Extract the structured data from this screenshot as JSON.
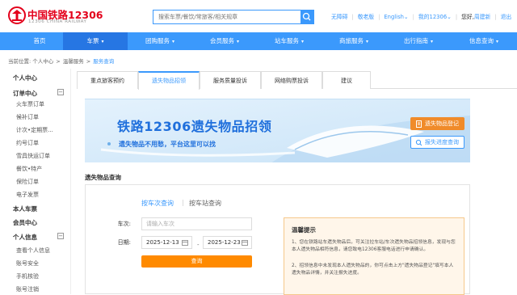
{
  "header": {
    "logo_cn": "中国铁路12306",
    "logo_en": "12306 CHINA RAILWAY",
    "search_placeholder": "搜索车票/餐饮/常旅客/相关规章",
    "links": [
      "无障碍",
      "敬老版",
      "English",
      "我的12306",
      "您好,",
      "周建新",
      "退出"
    ]
  },
  "nav": [
    {
      "label": "首页",
      "chev": false
    },
    {
      "label": "车票",
      "chev": true,
      "active": true
    },
    {
      "label": "团购服务",
      "chev": true
    },
    {
      "label": "会员服务",
      "chev": true
    },
    {
      "label": "站车服务",
      "chev": true
    },
    {
      "label": "商旅服务",
      "chev": true
    },
    {
      "label": "出行指南",
      "chev": true
    },
    {
      "label": "信息查询",
      "chev": true
    }
  ],
  "breadcrumb": {
    "prefix": "当前位置:",
    "items": [
      "个人中心",
      "温馨服务",
      "服务查询"
    ]
  },
  "sidebar": {
    "personal_center": "个人中心",
    "orders_heading": "订单中心",
    "orders_toggle": "−",
    "orders": [
      "火车票订单",
      "候补订单",
      "计次•定期票...",
      "约号订单",
      "雪具快运订单",
      "餐饮•特产",
      "保险订单",
      "电子发票"
    ],
    "my_tickets": "本人车票",
    "membership": "会员中心",
    "personal_info": "个人信息",
    "info_toggle": "−",
    "info_items": [
      "查看个人信息",
      "账号安全",
      "手机核验",
      "账号注销"
    ]
  },
  "tabs": [
    "重点旅客预约",
    "遗失物品招领",
    "服务质量投诉",
    "网络购票投诉",
    "建议"
  ],
  "active_tab": 1,
  "banner": {
    "title": "铁路12306遗失物品招领",
    "subtitle": "遗失物品不用愁，平台这里可以找",
    "register_button": "遗失物品登记",
    "progress_button": "报失进度查询"
  },
  "section_title": "遗失物品查询",
  "query": {
    "tab_train": "按车次查询",
    "tab_station": "按车站查询",
    "train_label": "车次:",
    "train_placeholder": "请输入车次",
    "date_label": "日期:",
    "date_from": "2025-12-13",
    "date_to": "2025-12-23",
    "date_sep": "-",
    "submit": "查询"
  },
  "tips": {
    "title": "温馨提示",
    "items": [
      "1、您在铁路站车遗失物品后，可关注拉车站/车次遗失物品招领信息，发现与您本人遗失物品相符信息，请您致电12306客服电话进行申请确认。",
      "2、招领信息中未发现本人遗失物品的，你可点击上方\"遗失物品登记\"填写本人遗失物品详情，并关注报失进度。"
    ]
  },
  "colors": {
    "brand_red": "#e3001b",
    "nav_blue": "#3b99fc",
    "accent_orange": "#ff8a00"
  }
}
